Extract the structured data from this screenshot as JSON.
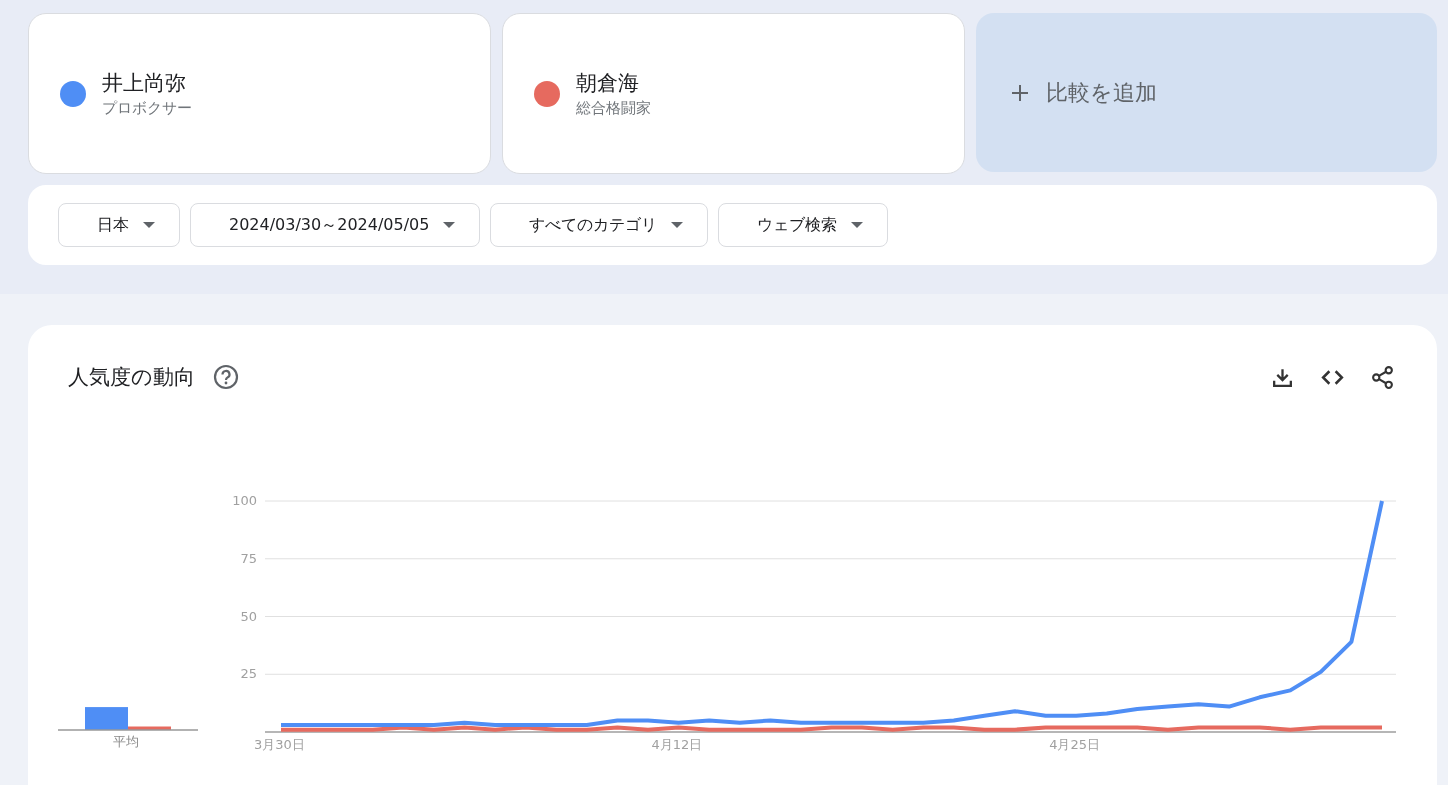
{
  "terms": [
    {
      "name": "井上尚弥",
      "type": "プロボクサー",
      "color": "#4f8ef5"
    },
    {
      "name": "朝倉海",
      "type": "総合格闘家",
      "color": "#e66a5f"
    }
  ],
  "add_compare": {
    "label": "比較を追加"
  },
  "filters": [
    {
      "label": "日本"
    },
    {
      "label": "2024/03/30～2024/05/05"
    },
    {
      "label": "すべてのカテゴリ"
    },
    {
      "label": "ウェブ検索"
    }
  ],
  "trend": {
    "title": "人気度の動向",
    "average_label": "平均",
    "chart_data": {
      "type": "line",
      "categories": [
        "3月30日",
        null,
        null,
        null,
        null,
        null,
        null,
        null,
        null,
        null,
        null,
        null,
        null,
        "4月12日",
        null,
        null,
        null,
        null,
        null,
        null,
        null,
        null,
        null,
        null,
        null,
        null,
        "4月25日",
        null,
        null,
        null,
        null,
        null,
        null,
        null,
        null,
        null,
        null
      ],
      "ylim": [
        0,
        100
      ],
      "grid": true,
      "yticks": [
        25,
        50,
        75,
        100
      ],
      "series": [
        {
          "color": "#4f8ef5",
          "values": [
            3,
            3,
            3,
            3,
            3,
            3,
            4,
            3,
            3,
            3,
            3,
            5,
            5,
            4,
            5,
            4,
            5,
            4,
            4,
            4,
            4,
            4,
            5,
            7,
            9,
            7,
            7,
            8,
            10,
            11,
            12,
            11,
            15,
            18,
            26,
            39,
            100
          ]
        },
        {
          "color": "#e66a5f",
          "values": [
            1,
            1,
            1,
            1,
            2,
            1,
            2,
            1,
            2,
            1,
            1,
            2,
            1,
            2,
            1,
            1,
            1,
            1,
            2,
            2,
            1,
            2,
            2,
            1,
            1,
            2,
            2,
            2,
            2,
            1,
            2,
            2,
            2,
            1,
            2,
            2,
            2
          ]
        }
      ]
    }
  }
}
